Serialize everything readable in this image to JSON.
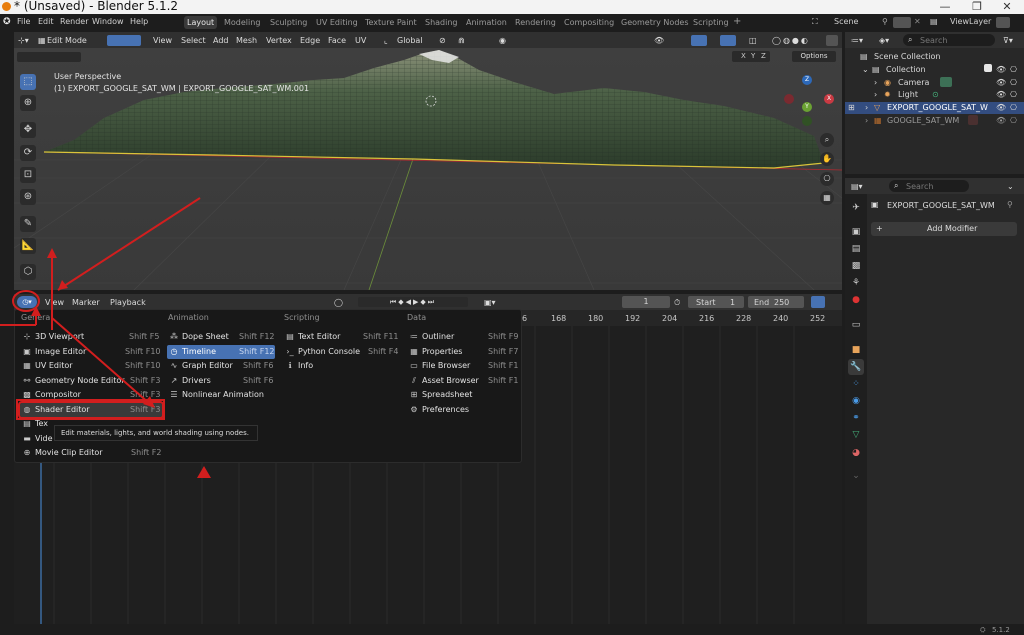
{
  "window": {
    "title": "* (Unsaved) - Blender 5.1.2",
    "minimize": "—",
    "maximize": "❐",
    "close": "✕"
  },
  "menubar": {
    "menus": [
      "File",
      "Edit",
      "Render",
      "Window",
      "Help"
    ],
    "workspaces": [
      "Layout",
      "Modeling",
      "Sculpting",
      "UV Editing",
      "Texture Paint",
      "Shading",
      "Animation",
      "Rendering",
      "Compositing",
      "Geometry Nodes",
      "Scripting"
    ],
    "active_workspace": "Layout",
    "add_workspace": "+",
    "scene_label": "Scene",
    "view_layer_label": "ViewLayer"
  },
  "viewport_header": {
    "mode": "Edit Mode",
    "menus": [
      "View",
      "Select",
      "Add",
      "Mesh",
      "Vertex",
      "Edge",
      "Face",
      "UV"
    ],
    "orientation": "Global",
    "options": "Options",
    "axes": [
      "X",
      "Y",
      "Z"
    ]
  },
  "viewport": {
    "perspective": "User Perspective",
    "object_line": "(1) EXPORT_GOOGLE_SAT_WM | EXPORT_GOOGLE_SAT_WM.001",
    "gizmo_axes": [
      "Z",
      "Y",
      "X"
    ]
  },
  "timeline_header": {
    "menus": [
      "View",
      "Marker",
      "Playback"
    ],
    "current_frame": "1",
    "start_label": "Start",
    "start_value": "1",
    "end_label": "End",
    "end_value": "250",
    "ruler": [
      "6",
      "168",
      "180",
      "192",
      "204",
      "216",
      "228",
      "240",
      "252"
    ]
  },
  "editor_menu": {
    "columns": [
      {
        "header": "General",
        "items": [
          {
            "label": "3D Viewport",
            "shortcut": "Shift F5",
            "icon": "3d-viewport-icon",
            "glyph": "⊹"
          },
          {
            "label": "Image Editor",
            "shortcut": "Shift F10",
            "icon": "image-editor-icon",
            "glyph": "▣"
          },
          {
            "label": "UV Editor",
            "shortcut": "Shift F10",
            "icon": "uv-editor-icon",
            "glyph": "▦"
          },
          {
            "label": "Geometry Node Editor",
            "shortcut": "Shift F3",
            "icon": "geometry-nodes-icon",
            "glyph": "⚯"
          },
          {
            "label": "Compositor",
            "shortcut": "Shift F3",
            "icon": "compositor-icon",
            "glyph": "▩"
          },
          {
            "label": "Shader Editor",
            "shortcut": "Shift F3",
            "icon": "shader-editor-icon",
            "glyph": "◍"
          },
          {
            "label": "Tex",
            "shortcut": "",
            "icon": "texture-node-icon",
            "glyph": "▤"
          },
          {
            "label": "Vide",
            "shortcut": "",
            "icon": "video-sequencer-icon",
            "glyph": "▬"
          },
          {
            "label": "Movie Clip Editor",
            "shortcut": "Shift F2",
            "icon": "movie-clip-icon",
            "glyph": "⊕"
          }
        ]
      },
      {
        "header": "Animation",
        "items": [
          {
            "label": "Dope Sheet",
            "shortcut": "Shift F12",
            "icon": "dope-sheet-icon",
            "glyph": "⁂"
          },
          {
            "label": "Timeline",
            "shortcut": "Shift F12",
            "icon": "timeline-icon",
            "glyph": "◷"
          },
          {
            "label": "Graph Editor",
            "shortcut": "Shift F6",
            "icon": "graph-editor-icon",
            "glyph": "∿"
          },
          {
            "label": "Drivers",
            "shortcut": "Shift F6",
            "icon": "drivers-icon",
            "glyph": "↗"
          },
          {
            "label": "Nonlinear Animation",
            "shortcut": "",
            "icon": "nla-icon",
            "glyph": "☰"
          }
        ]
      },
      {
        "header": "Scripting",
        "items": [
          {
            "label": "Text Editor",
            "shortcut": "Shift F11",
            "icon": "text-editor-icon",
            "glyph": "▤"
          },
          {
            "label": "Python Console",
            "shortcut": "Shift F4",
            "icon": "python-console-icon",
            "glyph": "›_"
          },
          {
            "label": "Info",
            "shortcut": "",
            "icon": "info-icon",
            "glyph": "ℹ"
          }
        ]
      },
      {
        "header": "Data",
        "items": [
          {
            "label": "Outliner",
            "shortcut": "Shift F9",
            "icon": "outliner-icon",
            "glyph": "≔"
          },
          {
            "label": "Properties",
            "shortcut": "Shift F7",
            "icon": "properties-icon",
            "glyph": "▦"
          },
          {
            "label": "File Browser",
            "shortcut": "Shift F1",
            "icon": "file-browser-icon",
            "glyph": "▭"
          },
          {
            "label": "Asset Browser",
            "shortcut": "Shift F1",
            "icon": "asset-browser-icon",
            "glyph": "⫽"
          },
          {
            "label": "Spreadsheet",
            "shortcut": "",
            "icon": "spreadsheet-icon",
            "glyph": "⊞"
          },
          {
            "label": "Preferences",
            "shortcut": "",
            "icon": "preferences-icon",
            "glyph": "⚙"
          }
        ]
      }
    ],
    "tooltip": "Edit materials, lights, and world shading using nodes."
  },
  "outliner": {
    "search_placeholder": "Search",
    "rows": [
      {
        "label": "Scene Collection",
        "glyph": "▤"
      },
      {
        "label": "Collection",
        "glyph": "▤"
      },
      {
        "label": "Camera",
        "glyph": "◉"
      },
      {
        "label": "Light",
        "glyph": "✹"
      },
      {
        "label": "EXPORT_GOOGLE_SAT_W",
        "glyph": "▽"
      },
      {
        "label": "GOOGLE_SAT_WM",
        "glyph": "▦"
      }
    ]
  },
  "properties": {
    "search_placeholder": "Search",
    "object_name": "EXPORT_GOOGLE_SAT_WM",
    "add_modifier": "Add Modifier",
    "add_modifier_plus": "+"
  },
  "status": {
    "version": "5.1.2"
  },
  "colors": {
    "accent": "#4772b3",
    "annotation_red": "#d21e1e",
    "bg": "#1d1d1d"
  }
}
